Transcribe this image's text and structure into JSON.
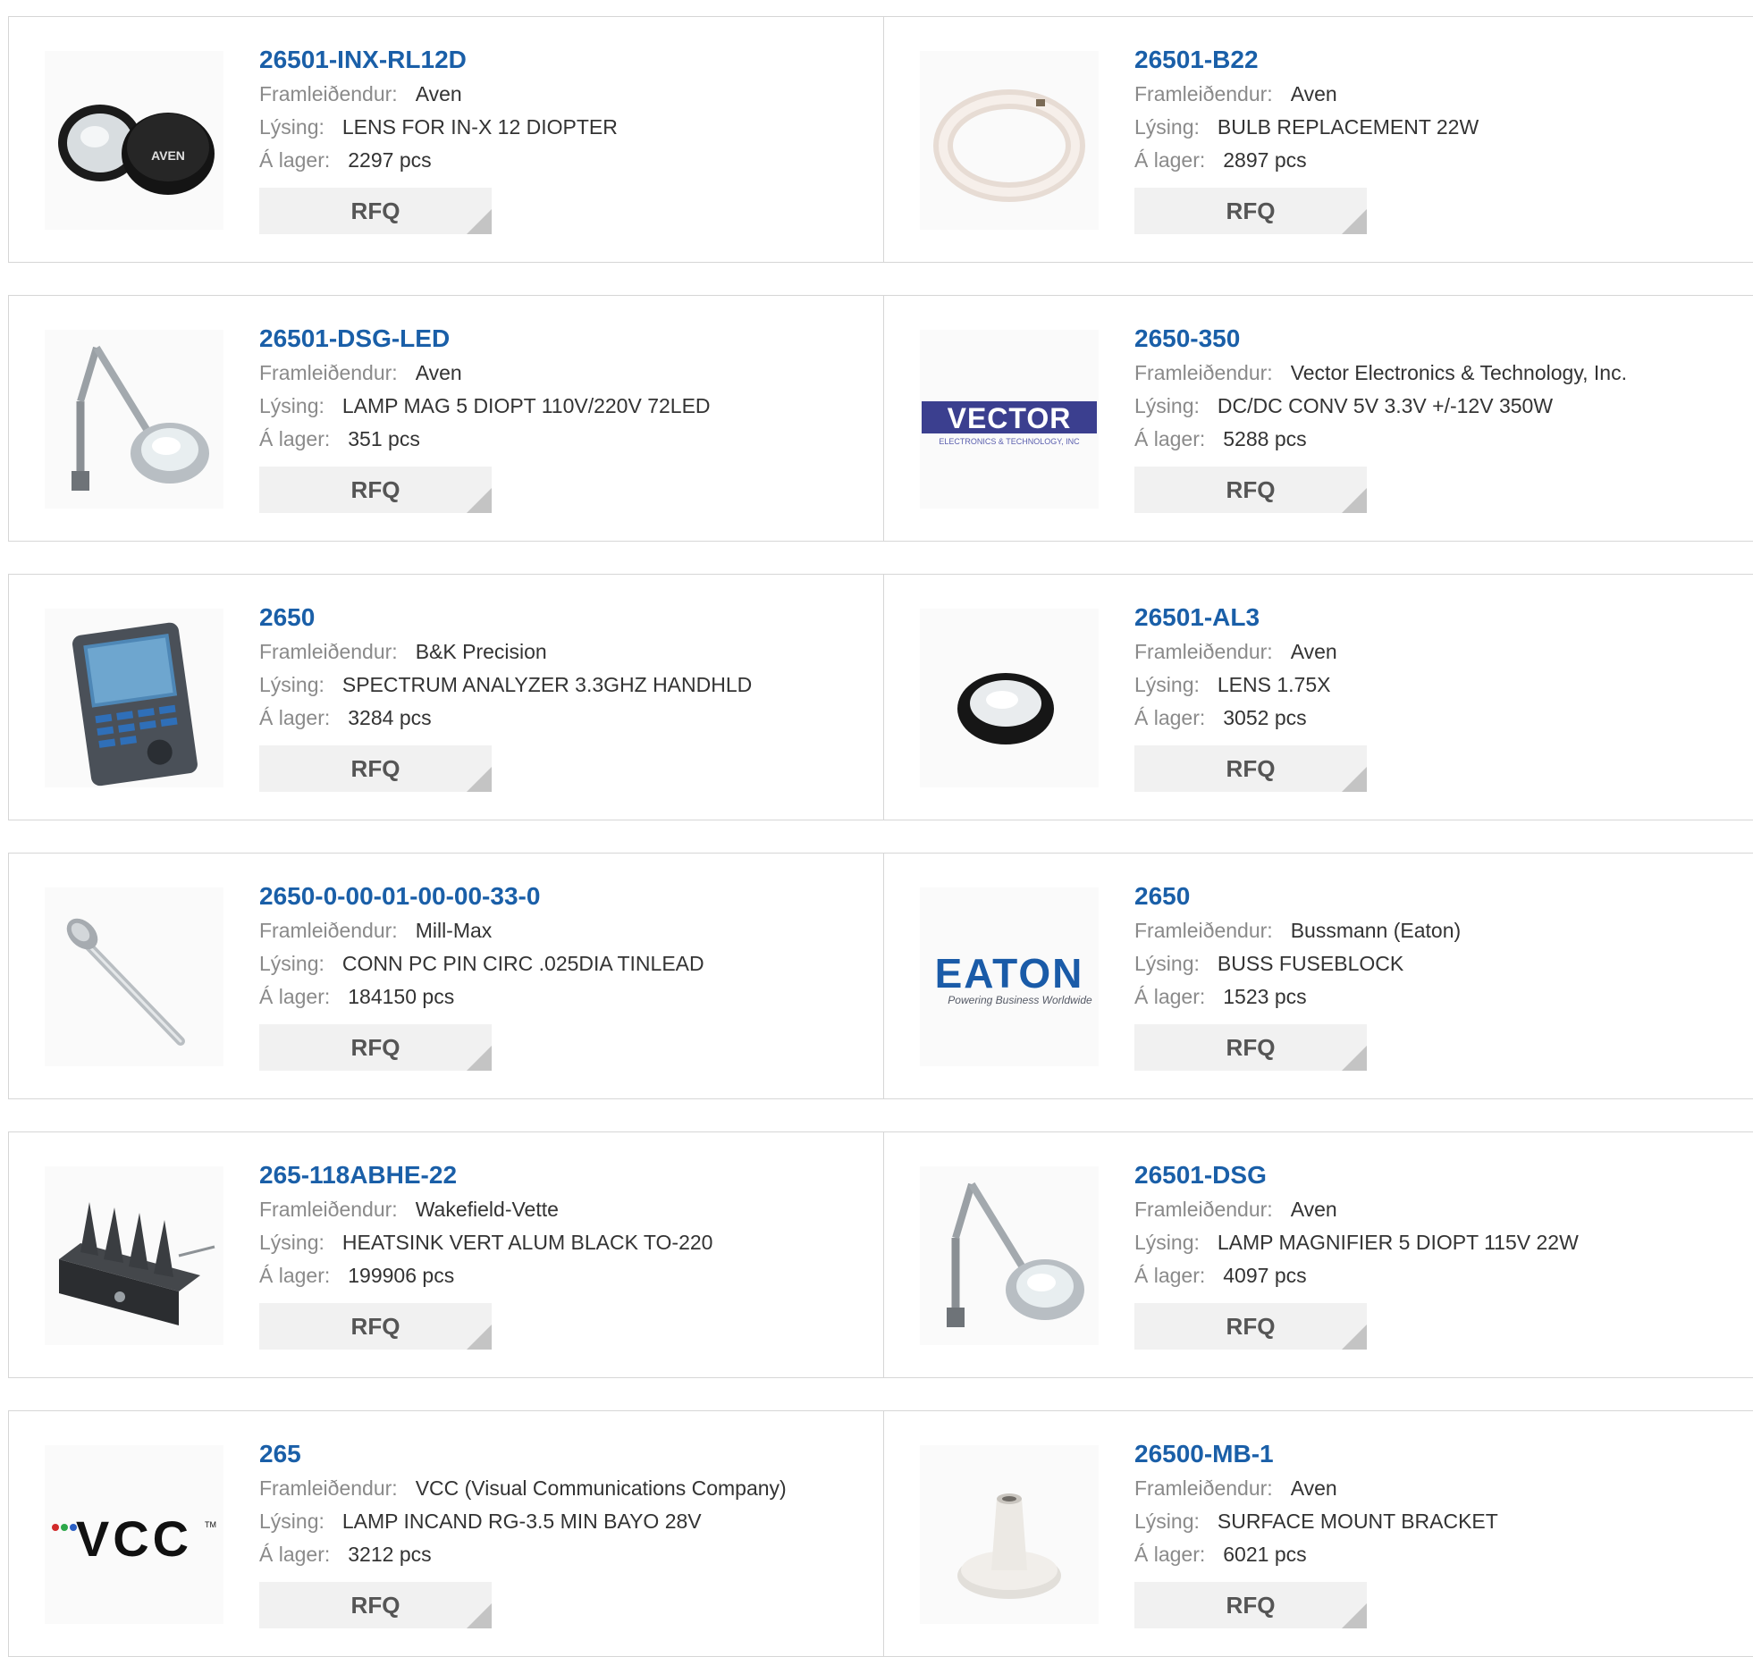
{
  "labels": {
    "manufacturer": "Framleiðendur:",
    "description": "Lýsing:",
    "stock": "Á lager:"
  },
  "products": [
    {
      "part": "26501-INX-RL12D",
      "manufacturer": "Aven",
      "description": "LENS FOR IN-X 12 DIOPTER",
      "stock": "2297 pcs",
      "button": "RFQ",
      "image": "lens-cap-photo",
      "image_text": "AVEN"
    },
    {
      "part": "26501-B22",
      "manufacturer": "Aven",
      "description": "BULB REPLACEMENT 22W",
      "stock": "2897 pcs",
      "button": "RFQ",
      "image": "ring-bulb-photo"
    },
    {
      "part": "26501-DSG-LED",
      "manufacturer": "Aven",
      "description": "LAMP MAG 5 DIOPT 110V/220V 72LED",
      "stock": "351 pcs",
      "button": "RFQ",
      "image": "magnifier-lamp-photo"
    },
    {
      "part": "2650-350",
      "manufacturer": "Vector Electronics & Technology, Inc.",
      "description": "DC/DC CONV 5V 3.3V +/-12V 350W",
      "stock": "5288 pcs",
      "button": "RFQ",
      "image": "vector-logo",
      "image_text": "VECTOR",
      "image_subtext": "ELECTRONICS & TECHNOLOGY, INC"
    },
    {
      "part": "2650",
      "manufacturer": "B&K Precision",
      "description": "SPECTRUM ANALYZER 3.3GHZ HANDHLD",
      "stock": "3284 pcs",
      "button": "RFQ",
      "image": "analyzer-photo"
    },
    {
      "part": "26501-AL3",
      "manufacturer": "Aven",
      "description": "LENS 1.75X",
      "stock": "3052 pcs",
      "button": "RFQ",
      "image": "lens-ring-photo"
    },
    {
      "part": "2650-0-00-01-00-00-33-0",
      "manufacturer": "Mill-Max",
      "description": "CONN PC PIN CIRC .025DIA TINLEAD",
      "stock": "184150 pcs",
      "button": "RFQ",
      "image": "pin-photo"
    },
    {
      "part": "2650",
      "manufacturer": "Bussmann (Eaton)",
      "description": "BUSS FUSEBLOCK",
      "stock": "1523 pcs",
      "button": "RFQ",
      "image": "eaton-logo",
      "image_text": "EATON",
      "image_subtext": "Powering Business Worldwide"
    },
    {
      "part": "265-118ABHE-22",
      "manufacturer": "Wakefield-Vette",
      "description": "HEATSINK VERT ALUM BLACK TO-220",
      "stock": "199906 pcs",
      "button": "RFQ",
      "image": "heatsink-photo"
    },
    {
      "part": "26501-DSG",
      "manufacturer": "Aven",
      "description": "LAMP MAGNIFIER 5 DIOPT 115V 22W",
      "stock": "4097 pcs",
      "button": "RFQ",
      "image": "magnifier-lamp-photo"
    },
    {
      "part": "265",
      "manufacturer": "VCC (Visual Communications Company)",
      "description": "LAMP INCAND RG-3.5 MIN BAYO 28V",
      "stock": "3212 pcs",
      "button": "RFQ",
      "image": "vcc-logo",
      "image_text": "VCC",
      "image_subtext": "TM"
    },
    {
      "part": "26500-MB-1",
      "manufacturer": "Aven",
      "description": "SURFACE MOUNT BRACKET",
      "stock": "6021 pcs",
      "button": "RFQ",
      "image": "bracket-photo"
    }
  ]
}
